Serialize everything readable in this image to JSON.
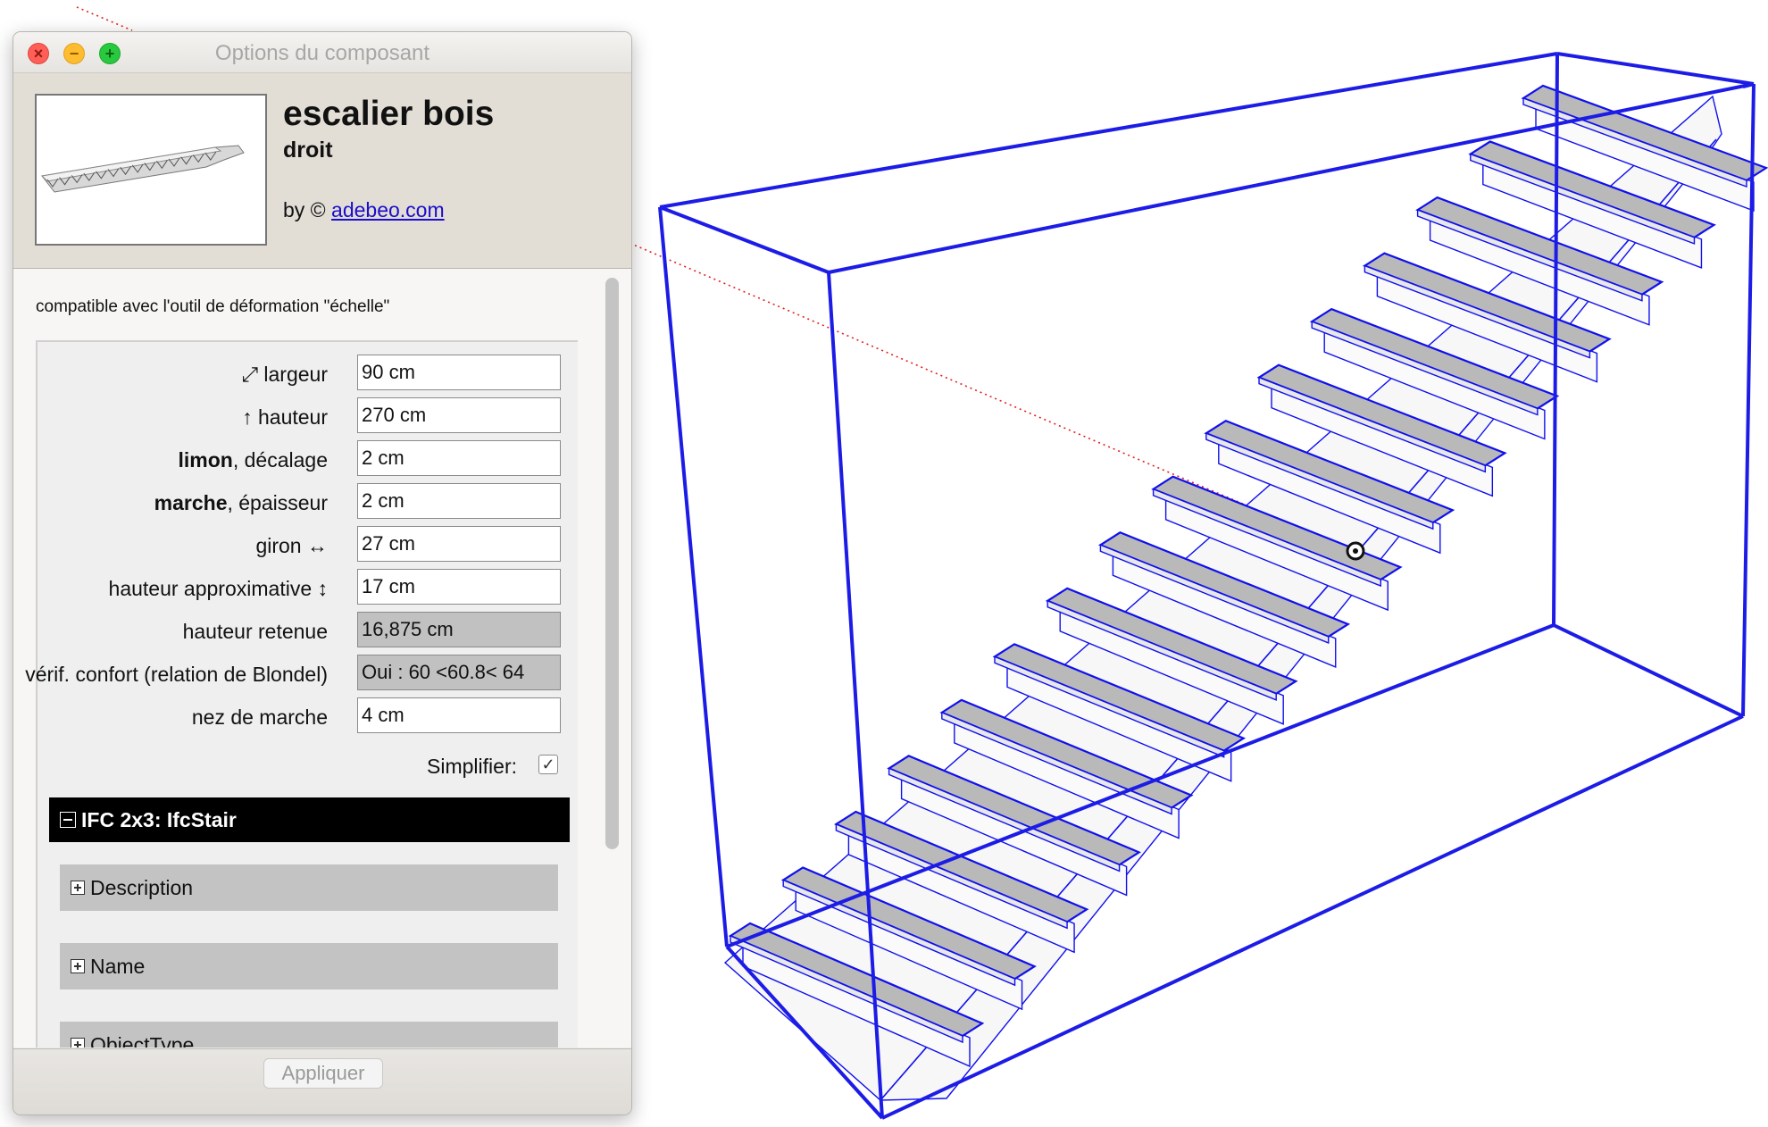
{
  "window": {
    "title": "Options du composant"
  },
  "component": {
    "name": "escalier bois",
    "subtitle": "droit",
    "by_prefix": "by © ",
    "author_link": "adebeo.com"
  },
  "compat_note": "compatible avec l'outil de déformation \"échelle\"",
  "params": [
    {
      "label_html": "⤢ largeur",
      "value": "90 cm",
      "readonly": false
    },
    {
      "label_html": "↑ hauteur",
      "value": "270 cm",
      "readonly": false
    },
    {
      "label_bold": "limon",
      "label_rest": ", décalage",
      "value": "2 cm",
      "readonly": false
    },
    {
      "label_bold": "marche",
      "label_rest": ", épaisseur",
      "value": "2 cm",
      "readonly": false
    },
    {
      "label_html": "giron ↔",
      "value": "27 cm",
      "readonly": false
    },
    {
      "label_html": "hauteur approximative ↕",
      "value": "17 cm",
      "readonly": false
    },
    {
      "label_html": "hauteur retenue",
      "value": "16,875 cm",
      "readonly": true
    },
    {
      "label_html": "vérif. confort (relation de Blondel)",
      "value": "Oui : 60 <60.8< 64",
      "readonly": true
    },
    {
      "label_html": "nez de marche",
      "value": "4 cm",
      "readonly": false
    }
  ],
  "simplify": {
    "label": "Simplifier:",
    "checked": true,
    "check_glyph": "✓"
  },
  "ifc": {
    "header": "IFC 2x3: IfcStair",
    "sections": [
      "Description",
      "Name",
      "ObjectType"
    ]
  },
  "footer": {
    "apply_label": "Appliquer"
  },
  "scene": {
    "steps": 16,
    "step_fill": "#b9b9b9",
    "edge_color": "#1010ee",
    "box_color": "#1c1ce6",
    "guide_color": "#e02020"
  },
  "colors": {
    "ifc_header_bg": "#000000",
    "section_bg": "#c3c3c3",
    "link": "#1a0dcc"
  }
}
